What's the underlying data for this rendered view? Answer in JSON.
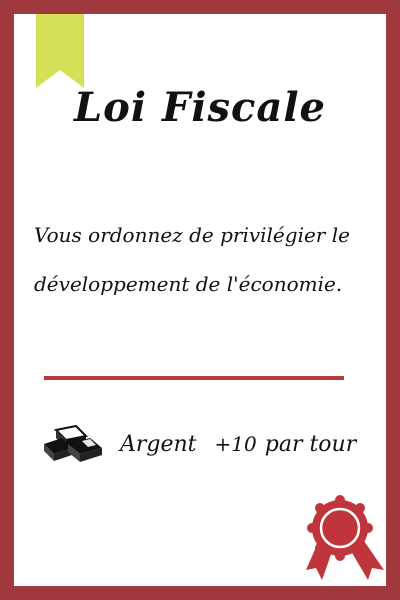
{
  "card": {
    "title": "Loi Fiscale",
    "description": "Vous ordonnez de privilégier le développement de l'économie.",
    "effect": {
      "resource": "Argent",
      "amount": "+10",
      "period": "par tour",
      "icon": "silver-bars-icon"
    }
  },
  "colors": {
    "border": "#a0393d",
    "divider": "#b83a3d",
    "bookmark": "#d4e157",
    "seal": "#c0353c"
  }
}
